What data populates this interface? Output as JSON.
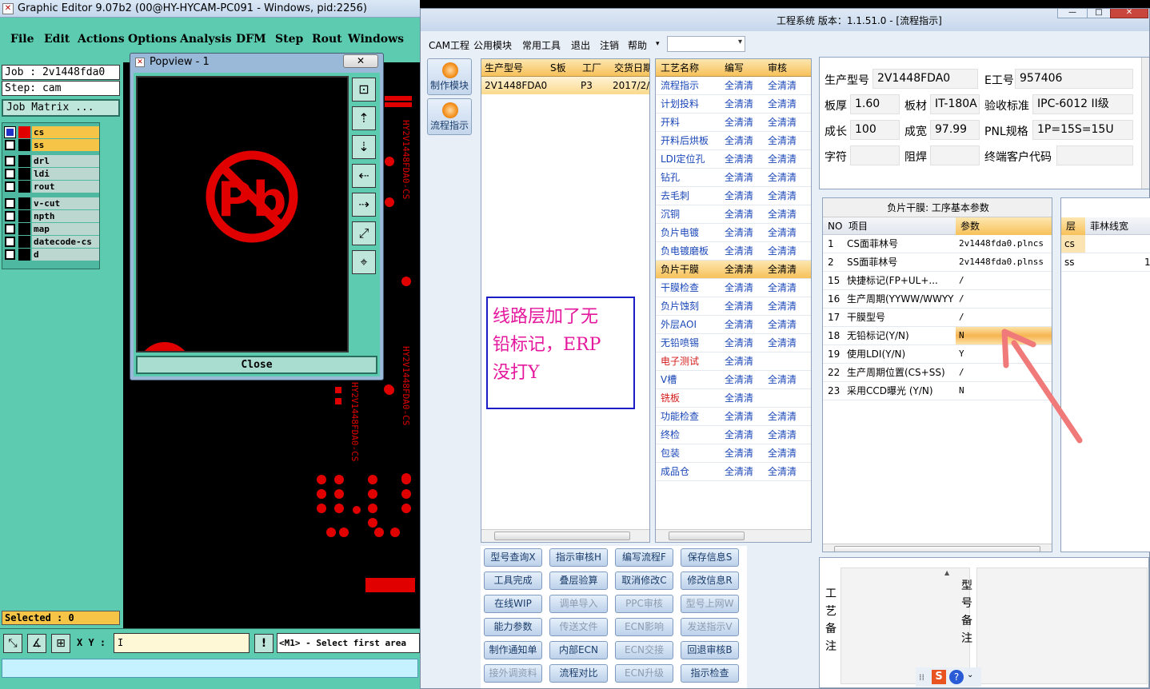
{
  "graphic_editor": {
    "title": "Graphic Editor 9.07b2 (00@HY-HYCAM-PC091 - Windows, pid:2256)",
    "menu": [
      "File",
      "Edit",
      "Actions",
      "Options",
      "Analysis",
      "DFM",
      "Step",
      "Rout",
      "Windows"
    ],
    "job": "Job : 2v1448fda0",
    "step": "Step: cam",
    "job_matrix": "Job Matrix ...",
    "layers": [
      {
        "name": "cs",
        "highlight": true
      },
      {
        "name": "ss",
        "highlight": true
      },
      {
        "name": "drl",
        "highlight": false
      },
      {
        "name": "ldi",
        "highlight": false
      },
      {
        "name": "rout",
        "highlight": false
      },
      {
        "name": "v-cut",
        "highlight": false
      },
      {
        "name": "npth",
        "highlight": false
      },
      {
        "name": "map",
        "highlight": false
      },
      {
        "name": "datecode-cs",
        "highlight": false
      },
      {
        "name": "d",
        "highlight": false
      }
    ],
    "selected": "Selected : 0",
    "xy_label": "X Y :",
    "xy_value": "I",
    "message": "<M1> - Select first area",
    "warn_icon": "!",
    "canvas_text": [
      "HY2V1448FDA0-CS",
      "HY2V1448FDA0-CS"
    ]
  },
  "popview": {
    "title": "Popview - 1",
    "close_x": "✕",
    "close_button": "Close"
  },
  "app": {
    "title": "工程系统  版本：1.1.51.0 - [流程指示]",
    "menu": [
      "CAM工程",
      "公用模块",
      "常用工具",
      "退出",
      "注销",
      "帮助"
    ],
    "side_buttons": [
      "制作模块",
      "流程指示"
    ],
    "product_table": {
      "headers": [
        "生产型号",
        "S板",
        "工厂",
        "交货日期"
      ],
      "rows": [
        [
          "2V1448FDA0",
          "",
          "P3",
          "2017/2/"
        ]
      ]
    },
    "process_table": {
      "headers": [
        "工艺名称",
        "编写",
        "审核"
      ],
      "rows": [
        {
          "name": "流程指示",
          "w": "全清清",
          "r": "全清清",
          "color": "#1a47b8"
        },
        {
          "name": "计划投料",
          "w": "全清清",
          "r": "全清清",
          "color": "#1a47b8"
        },
        {
          "name": "开料",
          "w": "全清清",
          "r": "全清清",
          "color": "#1a47b8"
        },
        {
          "name": "开料后烘板",
          "w": "全清清",
          "r": "全清清",
          "color": "#1a47b8"
        },
        {
          "name": "LDI定位孔",
          "w": "全清清",
          "r": "全清清",
          "color": "#1a47b8"
        },
        {
          "name": "钻孔",
          "w": "全清清",
          "r": "全清清",
          "color": "#1a47b8"
        },
        {
          "name": "去毛刺",
          "w": "全清清",
          "r": "全清清",
          "color": "#1a47b8"
        },
        {
          "name": "沉铜",
          "w": "全清清",
          "r": "全清清",
          "color": "#1a47b8"
        },
        {
          "name": "负片电镀",
          "w": "全清清",
          "r": "全清清",
          "color": "#1a47b8"
        },
        {
          "name": "负电镀磨板",
          "w": "全清清",
          "r": "全清清",
          "color": "#1a47b8"
        },
        {
          "name": "负片干膜",
          "w": "全清清",
          "r": "全清清",
          "color": "#000000",
          "selected": true
        },
        {
          "name": "干膜检查",
          "w": "全清清",
          "r": "全清清",
          "color": "#1a47b8"
        },
        {
          "name": "负片蚀刻",
          "w": "全清清",
          "r": "全清清",
          "color": "#1a47b8"
        },
        {
          "name": "外层AOI",
          "w": "全清清",
          "r": "全清清",
          "color": "#1a47b8"
        },
        {
          "name": "无铅喷锡",
          "w": "全清清",
          "r": "全清清",
          "color": "#1a47b8"
        },
        {
          "name": "电子测试",
          "w": "全清清",
          "r": "",
          "color": "#d41c1c"
        },
        {
          "name": "V槽",
          "w": "全清清",
          "r": "全清清",
          "color": "#1a47b8"
        },
        {
          "name": "铣板",
          "w": "全清清",
          "r": "",
          "color": "#d41c1c"
        },
        {
          "name": "功能检查",
          "w": "全清清",
          "r": "全清清",
          "color": "#1a47b8"
        },
        {
          "name": "终检",
          "w": "全清清",
          "r": "全清清",
          "color": "#1a47b8"
        },
        {
          "name": "包装",
          "w": "全清清",
          "r": "全清清",
          "color": "#1a47b8"
        },
        {
          "name": "成品仓",
          "w": "全清清",
          "r": "全清清",
          "color": "#1a47b8"
        }
      ]
    },
    "info": {
      "model_label": "生产型号",
      "model": "2V1448FDA0",
      "eno_label": "E工号",
      "eno": "957406",
      "thick_label": "板厚",
      "thick": "1.60",
      "material_label": "板材",
      "material": "IT-180A",
      "std_label": "验收标准",
      "std": "IPC-6012 II级",
      "len_label": "成长",
      "len": "100",
      "width_label": "成宽",
      "width": "97.99",
      "pnl_label": "PNL规格",
      "pnl": "1P=15S=15U",
      "char_label": "字符",
      "char": "",
      "mask_label": "阻焊",
      "mask": "",
      "cust_label": "终端客户代码",
      "cust": ""
    },
    "params": {
      "caption": "负片干膜: 工序基本参数",
      "headers": [
        "NO",
        "项目",
        "参数"
      ],
      "rows": [
        {
          "no": "1",
          "item": "CS面菲林号",
          "val": "2v1448fda0.plncs"
        },
        {
          "no": "2",
          "item": "SS面菲林号",
          "val": "2v1448fda0.plnss"
        },
        {
          "no": "15",
          "item": "快捷标记(FP+UL+...",
          "val": "/"
        },
        {
          "no": "16",
          "item": "生产周期(YYWW/WWYY)",
          "val": "/"
        },
        {
          "no": "17",
          "item": "干膜型号",
          "val": "/"
        },
        {
          "no": "18",
          "item": "无铅标记(Y/N)",
          "val": "N",
          "highlight": true
        },
        {
          "no": "19",
          "item": "使用LDI(Y/N)",
          "val": "Y"
        },
        {
          "no": "22",
          "item": "生产周期位置(CS+SS)",
          "val": "/"
        },
        {
          "no": "23",
          "item": "采用CCD曝光 (Y/N)",
          "val": "N"
        }
      ]
    },
    "layer_table": {
      "headers": [
        "层",
        "菲林线宽"
      ],
      "rows": [
        [
          "cs",
          ""
        ],
        [
          "ss",
          "1"
        ]
      ]
    },
    "notes": {
      "craft_label": [
        "工",
        "艺",
        "备",
        "注"
      ],
      "model_label": [
        "型",
        "号",
        "备",
        "注"
      ]
    },
    "buttons": [
      {
        "label": "型号查询X",
        "enabled": true
      },
      {
        "label": "指示审核H",
        "enabled": true
      },
      {
        "label": "编写流程F",
        "enabled": true
      },
      {
        "label": "保存信息S",
        "enabled": true
      },
      {
        "label": "工具完成",
        "enabled": true
      },
      {
        "label": "叠层验算",
        "enabled": true
      },
      {
        "label": "取消修改C",
        "enabled": true
      },
      {
        "label": "修改信息R",
        "enabled": true
      },
      {
        "label": "在线WIP",
        "enabled": true
      },
      {
        "label": "调单导入",
        "enabled": false
      },
      {
        "label": "PPC审核",
        "enabled": false
      },
      {
        "label": "型号上网W",
        "enabled": false
      },
      {
        "label": "能力参数",
        "enabled": true
      },
      {
        "label": "传送文件",
        "enabled": false
      },
      {
        "label": "ECN影响",
        "enabled": false
      },
      {
        "label": "发送指示V",
        "enabled": false
      },
      {
        "label": "制作通知单",
        "enabled": true
      },
      {
        "label": "内部ECN",
        "enabled": true
      },
      {
        "label": "ECN交接",
        "enabled": false
      },
      {
        "label": "回退审核B",
        "enabled": true
      },
      {
        "label": "接外调资料",
        "enabled": false
      },
      {
        "label": "流程对比",
        "enabled": true
      },
      {
        "label": "ECN升级",
        "enabled": false
      },
      {
        "label": "指示检查",
        "enabled": true
      }
    ]
  },
  "annotation": {
    "text_line1": "线路层加了无",
    "text_line2": "铅标记，ERP",
    "text_line3": "没打Y"
  },
  "tray": {
    "ime": "S",
    "help": "?"
  }
}
